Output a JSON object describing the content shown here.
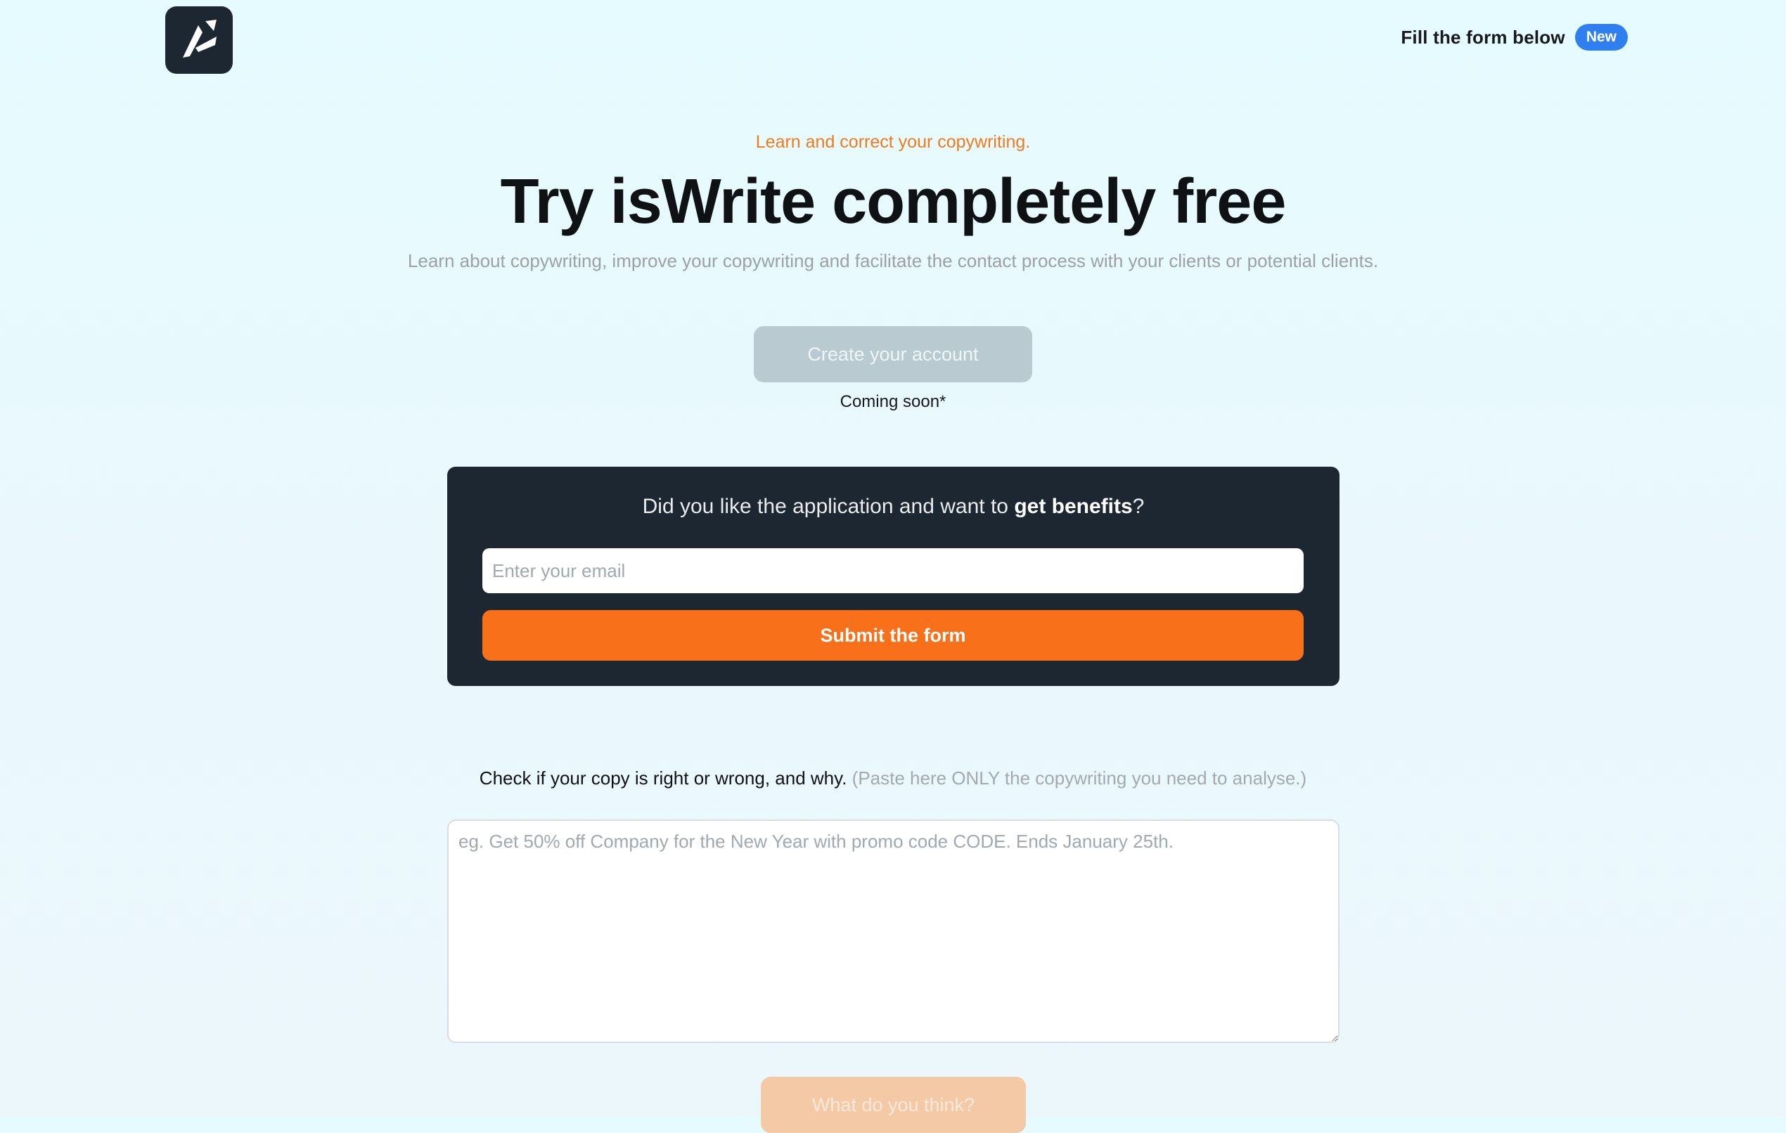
{
  "header": {
    "cta_text": "Fill the form below",
    "badge": "New"
  },
  "hero": {
    "eyebrow": "Learn and correct your copywriting.",
    "title": "Try isWrite completely free",
    "subtitle": "Learn about copywriting, improve your copywriting and facilitate the contact process with your clients or potential clients.",
    "create_account_label": "Create your account",
    "coming_soon": "Coming soon*"
  },
  "benefits": {
    "heading_prefix": "Did you like the application and want to ",
    "heading_bold": "get benefits",
    "heading_suffix": "?",
    "email_placeholder": "Enter your email",
    "email_value": "",
    "submit_label": "Submit the form"
  },
  "analyzer": {
    "label": "Check if your copy is right or wrong, and why.",
    "hint": "(Paste here ONLY the copywriting you need to analyse.)",
    "placeholder": "eg. Get 50% off Company for the New Year with promo code CODE. Ends January 25th.",
    "value": "",
    "submit_label": "What do you think?"
  },
  "colors": {
    "accent": "#f8711a",
    "badge": "#2f7ff0",
    "card_bg": "#1c2731",
    "disabled_button": "#b9cbd1"
  },
  "icons": {
    "logo": "iswrite-logo-icon"
  }
}
